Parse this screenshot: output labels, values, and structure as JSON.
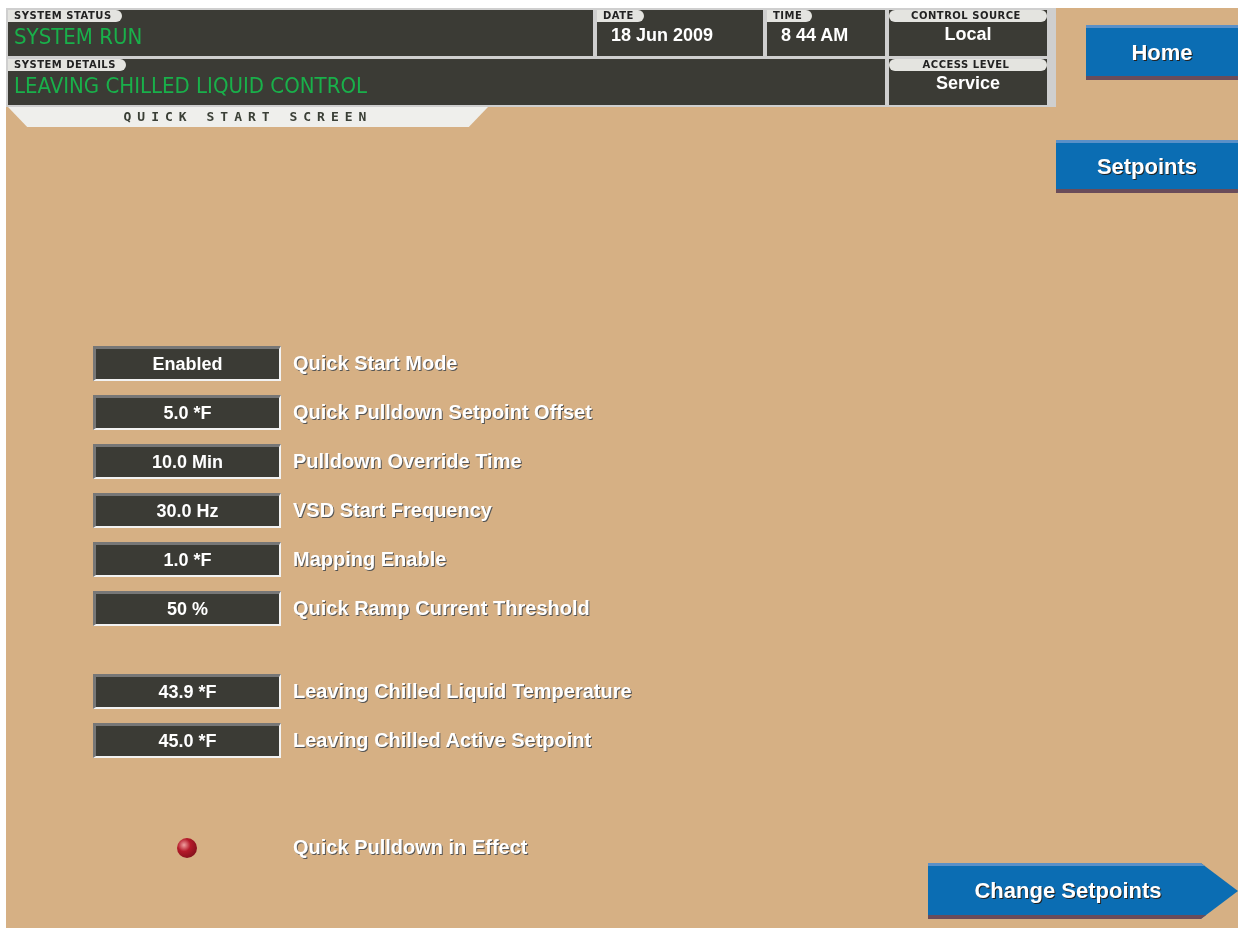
{
  "header": {
    "system_status": {
      "label": "SYSTEM STATUS",
      "value": "SYSTEM RUN"
    },
    "system_details": {
      "label": "SYSTEM DETAILS",
      "value": "LEAVING CHILLED LIQUID CONTROL"
    },
    "date": {
      "label": "DATE",
      "value": "18 Jun 2009"
    },
    "time": {
      "label": "TIME",
      "value": "8 44 AM"
    },
    "control_source": {
      "label": "CONTROL SOURCE",
      "value": "Local"
    },
    "access_level": {
      "label": "ACCESS LEVEL",
      "value": "Service"
    }
  },
  "screen_title": "QUICK START SCREEN",
  "nav_buttons": [
    "Home",
    "Setpoints"
  ],
  "groups": [
    {
      "rows": [
        {
          "kind": "value",
          "value": "Enabled",
          "label": "Quick Start Mode"
        },
        {
          "kind": "value",
          "value": "5.0 *F",
          "label": "Quick Pulldown Setpoint Offset"
        },
        {
          "kind": "value",
          "value": "10.0 Min",
          "label": "Pulldown Override Time"
        },
        {
          "kind": "value",
          "value": "30.0 Hz",
          "label": "VSD Start Frequency"
        },
        {
          "kind": "value",
          "value": "1.0 *F",
          "label": "Mapping Enable"
        },
        {
          "kind": "value",
          "value": "50 %",
          "label": "Quick Ramp Current Threshold"
        }
      ]
    },
    {
      "rows": [
        {
          "kind": "value",
          "value": "43.9 *F",
          "label": "Leaving Chilled Liquid Temperature"
        },
        {
          "kind": "value",
          "value": "45.0 *F",
          "label": "Leaving Chilled Active Setpoint"
        }
      ]
    },
    {
      "rows": [
        {
          "kind": "indicator",
          "on": true,
          "label": "Quick Pulldown in Effect"
        }
      ]
    }
  ],
  "action_button": "Change Setpoints"
}
